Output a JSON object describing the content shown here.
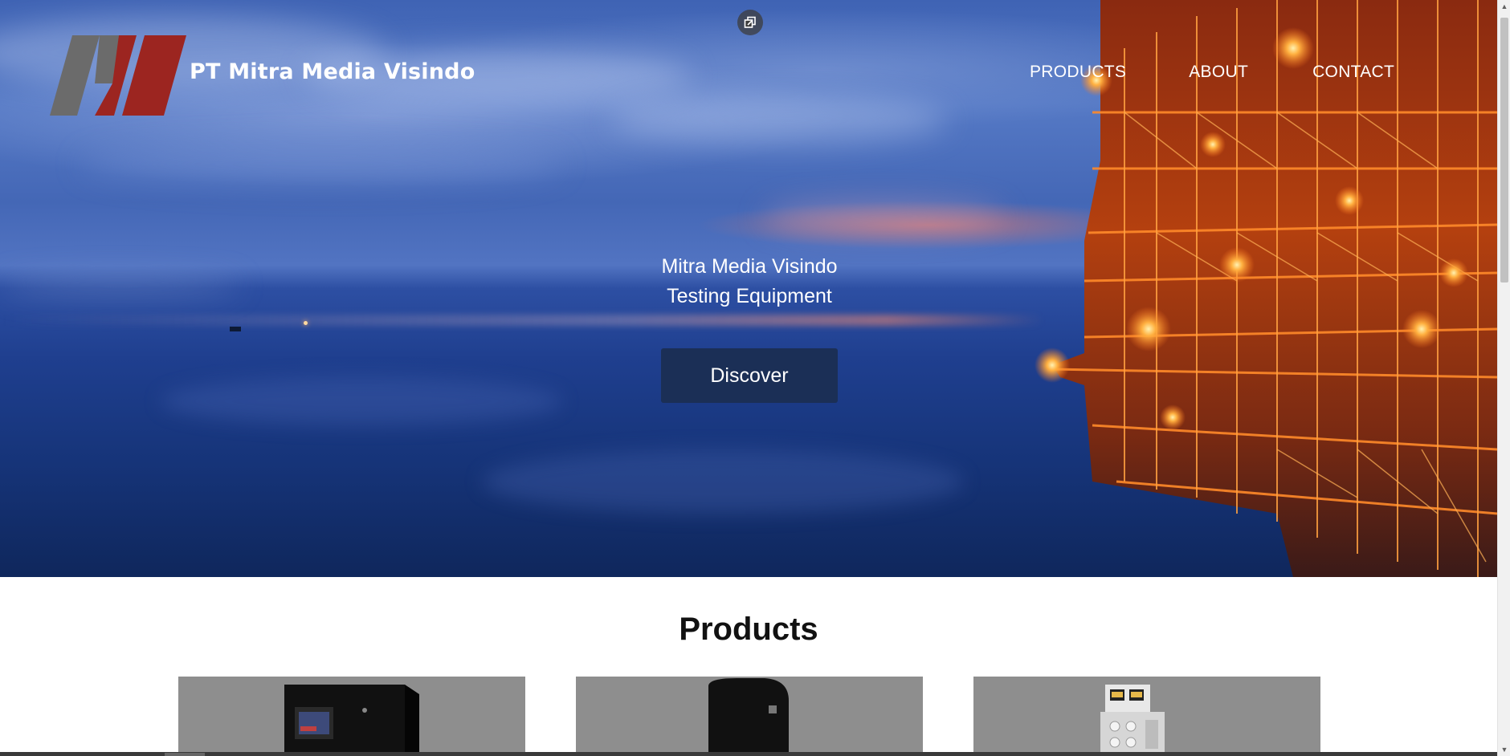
{
  "header": {
    "brand": "PT Mitra Media Visindo",
    "nav": [
      "PRODUCTS",
      "ABOUT",
      "CONTACT"
    ]
  },
  "hero": {
    "tagline_line1": "Mitra Media Visindo",
    "tagline_line2": "Testing Equipment",
    "cta_label": "Discover"
  },
  "products": {
    "heading": "Products",
    "cards": [
      {
        "icon": "black-cabinet-with-screen"
      },
      {
        "icon": "black-cylinder-unit"
      },
      {
        "icon": "white-panel-unit"
      }
    ]
  },
  "colors": {
    "cta_background": "#1b2f56",
    "logo_gray": "#6b6b6b",
    "logo_red": "#9c2520",
    "card_background": "#8e8e8e"
  },
  "icons": {
    "float": "external-window-icon",
    "scroll_up": "arrow-up-icon",
    "scroll_down": "arrow-down-icon"
  }
}
